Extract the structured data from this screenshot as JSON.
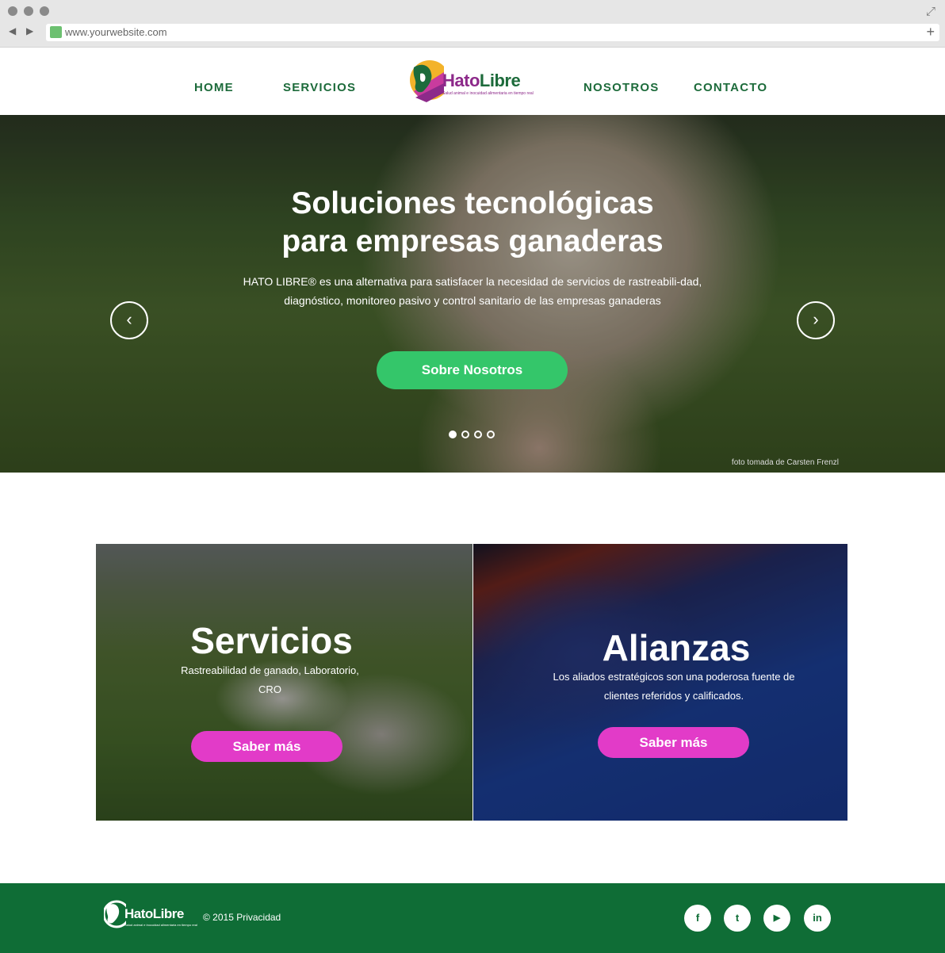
{
  "browser": {
    "url": "www.yourwebsite.com"
  },
  "nav": {
    "home": "HOME",
    "servicios": "SERVICIOS",
    "nosotros": "NOSOTROS",
    "contacto": "CONTACTO",
    "logo_text_a": "Hato",
    "logo_text_b": "Libre",
    "logo_tagline": "Salud animal e inocuidad alimentaria en tiempo real"
  },
  "hero": {
    "title_line1": "Soluciones tecnológicas",
    "title_line2": "para empresas ganaderas",
    "subtitle": "HATO LIBRE® es una alternativa para satisfacer la necesidad de servicios de rastreabili-dad, diagnóstico, monitoreo pasivo y control sanitario de las empresas ganaderas",
    "button": "Sobre Nosotros",
    "credit": "foto tomada de Carsten Frenzl",
    "prev_icon": "‹",
    "next_icon": "›",
    "slides": 4,
    "active_slide": 1
  },
  "cards": {
    "servicios": {
      "title": "Servicios",
      "subtitle": "Rastreabilidad de ganado, Laboratorio, CRO",
      "button": "Saber más"
    },
    "alianzas": {
      "title": "Alianzas",
      "subtitle": "Los aliados estratégicos son una poderosa fuente de clientes referidos y calificados.",
      "button": "Saber más"
    }
  },
  "footer": {
    "logo_text": "HatoLibre",
    "logo_tagline": "Salud animal e inocuidad alimentaria en tiempo real",
    "copyright": "© 2015  Privacidad",
    "social": {
      "facebook": "f",
      "twitter": "t",
      "youtube": "▶",
      "linkedin": "in"
    }
  },
  "colors": {
    "nav_green": "#1d6b3b",
    "brand_purple": "#8d2a8a",
    "hero_button": "#34c66a",
    "card_button": "#e23bc8",
    "footer_bg": "#0f6d36"
  }
}
